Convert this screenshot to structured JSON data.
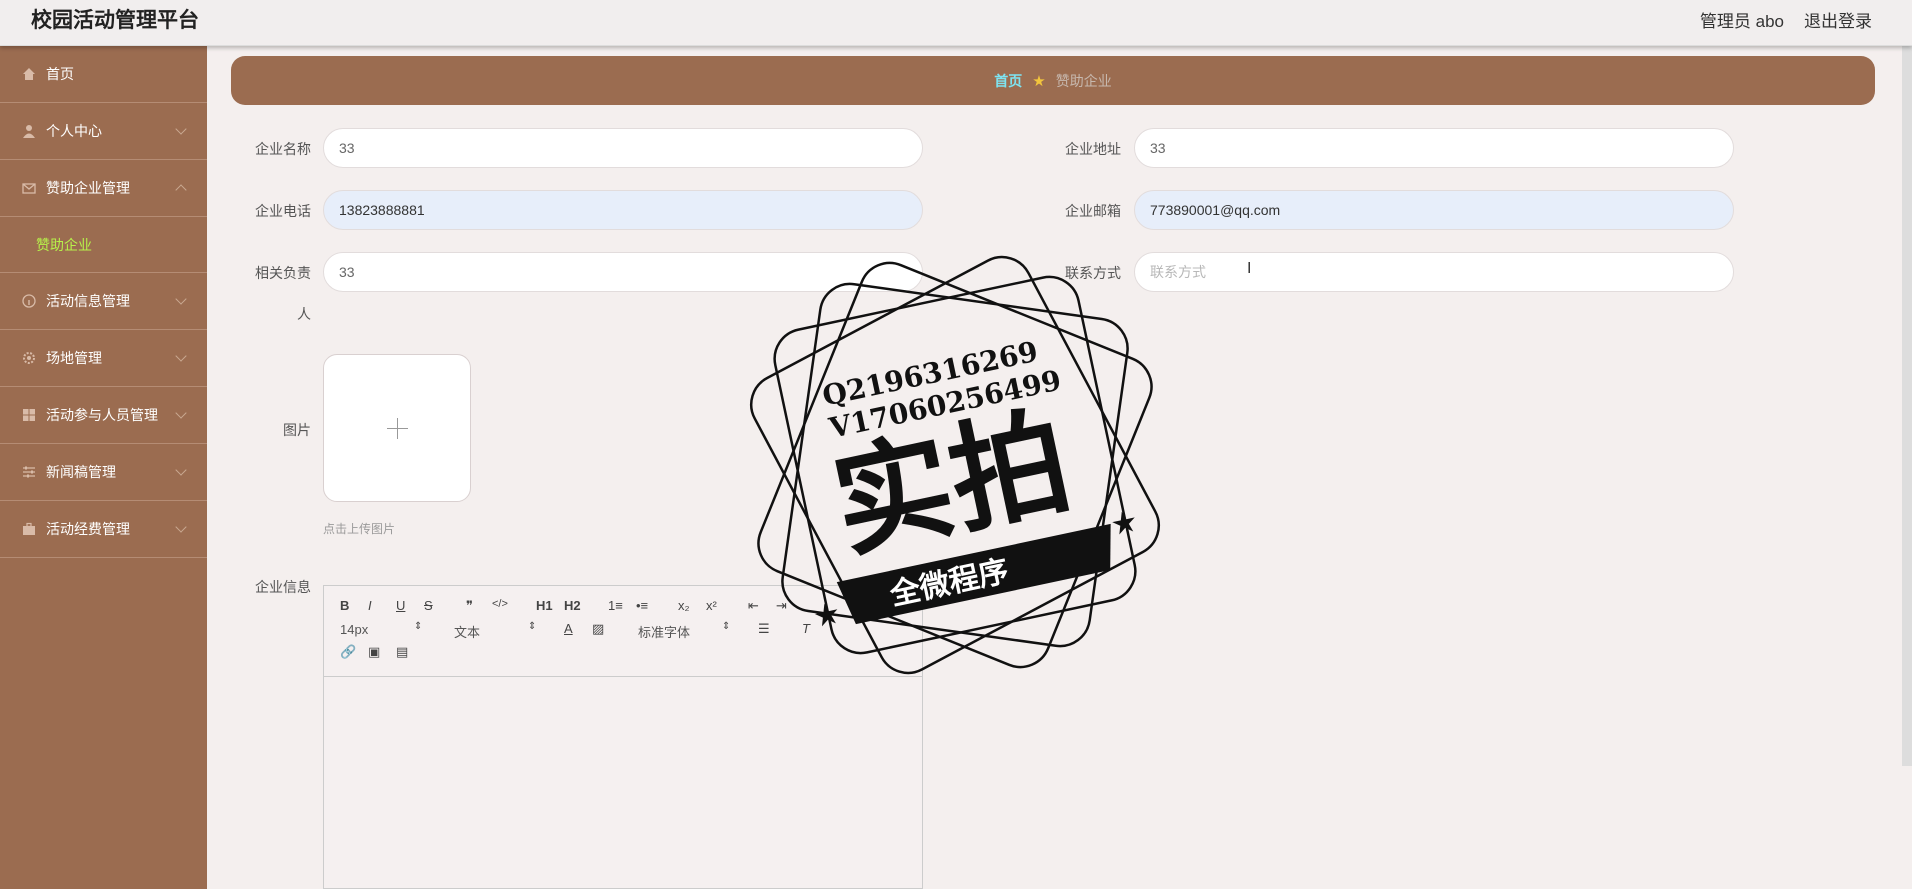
{
  "header": {
    "app_title": "校园活动管理平台",
    "user_label": "管理员 abo",
    "logout_label": "退出登录"
  },
  "sidebar": {
    "items": [
      {
        "label": "首页",
        "icon": "home-icon"
      },
      {
        "label": "个人中心",
        "icon": "user-icon"
      },
      {
        "label": "赞助企业管理",
        "icon": "mail-icon",
        "expanded": true,
        "children": [
          {
            "label": "赞助企业"
          }
        ]
      },
      {
        "label": "活动信息管理",
        "icon": "info-icon"
      },
      {
        "label": "场地管理",
        "icon": "gear-icon"
      },
      {
        "label": "活动参与人员管理",
        "icon": "grid-icon"
      },
      {
        "label": "新闻稿管理",
        "icon": "sliders-icon"
      },
      {
        "label": "活动经费管理",
        "icon": "briefcase-icon"
      }
    ],
    "active_color": "#b7f24a"
  },
  "breadcrumb": {
    "home": "首页",
    "current": "赞助企业"
  },
  "form": {
    "company_name": {
      "label": "企业名称",
      "value": "33"
    },
    "company_address": {
      "label": "企业地址",
      "value": "33"
    },
    "company_phone": {
      "label": "企业电话",
      "value": "13823888881"
    },
    "company_email": {
      "label": "企业邮箱",
      "value": "773890001@qq.com"
    },
    "contact_person": {
      "label_line1": "相关负责",
      "label_line2": "人",
      "value": "33"
    },
    "contact_method": {
      "label": "联系方式",
      "placeholder": "联系方式"
    },
    "image": {
      "label": "图片",
      "tip": "点击上传图片"
    },
    "company_info": {
      "label": "企业信息"
    }
  },
  "editor": {
    "font_size": "14px",
    "text_type": "文本",
    "font_family": "标准字体",
    "buttons": [
      "B",
      "I",
      "U",
      "S",
      "❞",
      "</>",
      "H1",
      "H2",
      "1≡",
      "•≡",
      "x₂",
      "x²",
      "⇤",
      "⇥"
    ]
  },
  "watermark": {
    "line1": "Q2196316269",
    "line2": "V17060256499",
    "main": "实拍",
    "banner": "全微程序"
  },
  "colors": {
    "sidebar": "#9b6c50",
    "breadcrumb_home": "#7ee3f0",
    "star": "#f2c53d"
  }
}
